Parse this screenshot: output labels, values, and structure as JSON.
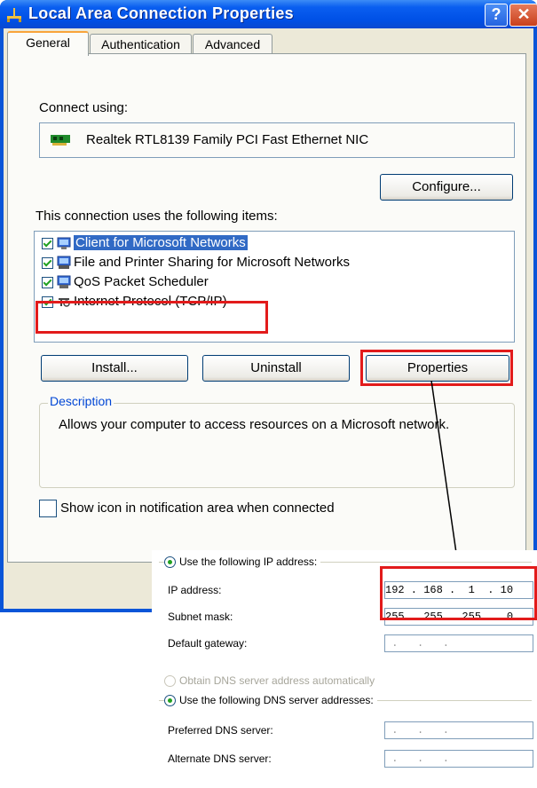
{
  "window": {
    "title": "Local Area Connection Properties",
    "help_glyph": "?",
    "close_glyph": "✕"
  },
  "tabs": [
    {
      "label": "General",
      "active": true
    },
    {
      "label": "Authentication",
      "active": false
    },
    {
      "label": "Advanced",
      "active": false
    }
  ],
  "general": {
    "connect_using_label": "Connect using:",
    "adapter_name": "Realtek RTL8139 Family PCI Fast Ethernet NIC",
    "configure_button": "Configure...",
    "items_label": "This connection uses the following items:",
    "items": [
      {
        "label": "Client for Microsoft Networks",
        "checked": true,
        "selected": true,
        "icon": "network-client-icon"
      },
      {
        "label": "File and Printer Sharing for Microsoft Networks",
        "checked": true,
        "selected": false,
        "icon": "file-printer-sharing-icon"
      },
      {
        "label": "QoS Packet Scheduler",
        "checked": true,
        "selected": false,
        "icon": "qos-scheduler-icon"
      },
      {
        "label": "Internet Protocol (TCP/IP)",
        "checked": true,
        "selected": false,
        "icon": "protocol-icon"
      }
    ],
    "install_button": "Install...",
    "uninstall_button": "Uninstall",
    "properties_button": "Properties",
    "description_title": "Description",
    "description_text": "Allows your computer to access resources on a Microsoft network.",
    "show_icon_label": "Show icon in notification area when connected",
    "show_icon_checked": false
  },
  "tcpip": {
    "use_following_ip_label": "Use the following IP address:",
    "ip_address_label": "IP address:",
    "ip_address_value": "192 . 168 .  1  . 10",
    "subnet_mask_label": "Subnet mask:",
    "subnet_mask_value": "255 . 255 . 255 .  0",
    "default_gateway_label": "Default gateway:",
    "default_gateway_value": " .   .   . ",
    "obtain_dns_label": "Obtain DNS server address automatically",
    "use_following_dns_label": "Use the following DNS server addresses:",
    "preferred_dns_label": "Preferred DNS server:",
    "preferred_dns_value": " .   .   . ",
    "alternate_dns_label": "Alternate DNS server:",
    "alternate_dns_value": " .   .   . "
  },
  "colors": {
    "highlight_box": "#e21b1b",
    "title_bar": "#0a55d8",
    "selection": "#316ac5",
    "description_title": "#0046d5"
  }
}
